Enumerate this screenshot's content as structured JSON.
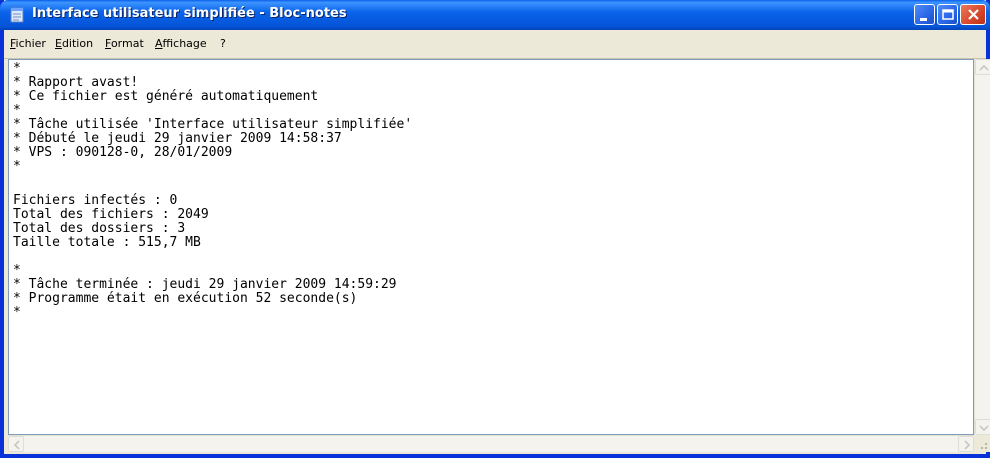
{
  "window": {
    "title": "Interface utilisateur simplifiée - Bloc-notes",
    "app_icon": "notepad-icon",
    "controls": [
      "minimize-icon",
      "maximize-icon",
      "close-icon"
    ]
  },
  "menu": {
    "items": [
      "Fichier",
      "Edition",
      "Format",
      "Affichage",
      "?"
    ]
  },
  "document": {
    "lines": [
      "*",
      "* Rapport avast!",
      "* Ce fichier est généré automatiquement",
      "*",
      "* Tâche utilisée 'Interface utilisateur simplifiée'",
      "* Débuté le jeudi 29 janvier 2009 14:58:37",
      "* VPS : 090128-0, 28/01/2009",
      "*",
      "",
      "Fichiers infectés : 0",
      "Total des fichiers : 2049",
      "Total des dossiers : 3",
      "Taille totale : 515,7 MB",
      "",
      "*",
      "* Tâche terminée : jeudi 29 janvier 2009 14:59:29",
      "* Programme était en exécution 52 seconde(s)",
      "*"
    ]
  },
  "scrollbars": {
    "vertical": {
      "up": "scroll-up-arrow-icon",
      "down": "scroll-down-arrow-icon"
    },
    "horizontal": {
      "left": "scroll-left-arrow-icon",
      "right": "scroll-right-arrow-icon"
    }
  },
  "colors": {
    "titlebar": "#0554d8",
    "frame": "#0831d9",
    "close_button": "#d8462a",
    "menubar": "#ece9d8"
  }
}
